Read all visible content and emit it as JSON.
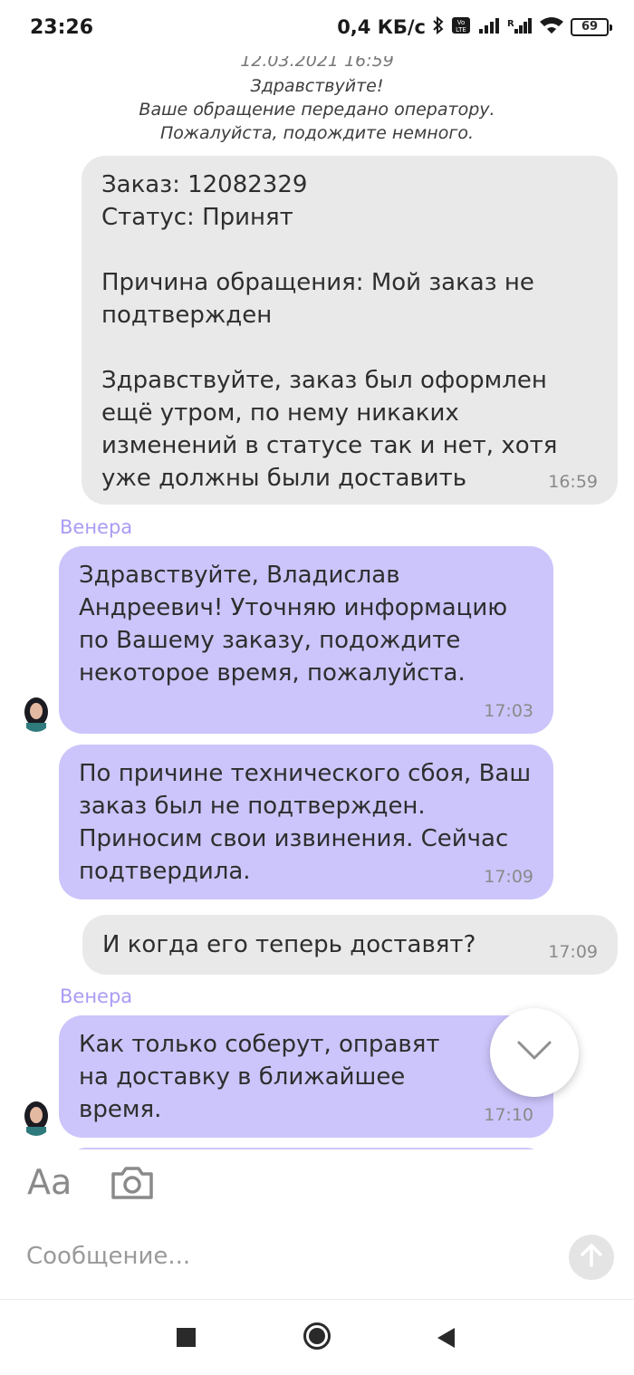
{
  "status_bar": {
    "time": "23:26",
    "net_speed": "0,4 КБ/с",
    "battery": "69",
    "icons": [
      "bluetooth-icon",
      "volte-icon",
      "signal-icon",
      "signal-r-icon",
      "wifi-icon",
      "battery-icon"
    ]
  },
  "chat": {
    "system": {
      "date": "12.03.2021 16:59",
      "line1": "Здравствуйте!",
      "line2": "Ваше обращение передано оператору.",
      "line3": "Пожалуйста, подождите немного."
    },
    "messages": [
      {
        "direction": "outgoing",
        "text": "Заказ: 12082329\nСтатус: Принят\n\nПричина обращения: Мой заказ не подтвержден\n\nЗдравствуйте, заказ был оформлен ещё утром, по нему никаких изменений в статусе так и нет, хотя уже должны были доставить",
        "time": "16:59"
      },
      {
        "direction": "incoming",
        "sender": "Венера",
        "text": "Здравствуйте, Владислав Андреевич! Уточняю информацию по Вашему заказу, подождите некоторое время, пожалуйста.",
        "time": "17:03"
      },
      {
        "direction": "incoming",
        "text": "По причине технического сбоя, Ваш заказ был не подтвержден. Приносим свои извинения. Сейчас подтвердила.",
        "time": "17:09"
      },
      {
        "direction": "outgoing",
        "text": "И когда его теперь доставят?",
        "time": "17:09"
      },
      {
        "direction": "incoming",
        "sender": "Венера",
        "text": "Как только соберут, оправят на доставку в ближайшее время.",
        "time": "17:10"
      }
    ]
  },
  "composer": {
    "format_label": "Aa",
    "placeholder": "Сообщение..."
  },
  "colors": {
    "incoming_bubble": "#cbc5fb",
    "outgoing_bubble": "#e9e9ea",
    "sender_name": "#a99cf4"
  }
}
